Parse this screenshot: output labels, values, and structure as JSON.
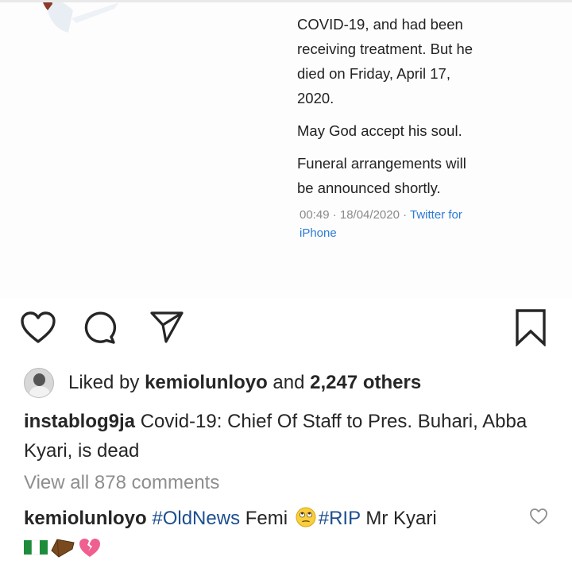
{
  "tweet": {
    "lines_p1": [
      "COVID-19, and had been",
      "receiving treatment. But he",
      "died on Friday, April 17,",
      "2020."
    ],
    "line_p2": "May God accept his soul.",
    "lines_p3": [
      "Funeral arrangements will",
      "be announced shortly."
    ],
    "meta_time": "00:49 · 18/04/2020 · ",
    "meta_source_1": "Twitter for",
    "meta_source_2": "iPhone"
  },
  "actions": {
    "like_icon": "heart-icon",
    "comment_icon": "comment-bubble-icon",
    "share_icon": "paper-plane-icon",
    "save_icon": "bookmark-icon"
  },
  "likes": {
    "prefix": "Liked by ",
    "user": "kemiolunloyo",
    "middle": " and ",
    "count": "2,247 others"
  },
  "caption": {
    "username": "instablog9ja",
    "text": " Covid-19: Chief Of Staff to Pres. Buhari, Abba Kyari, is dead"
  },
  "view_comments": "View all 878 comments",
  "comment": {
    "username": "kemiolunloyo",
    "hashtag1": "#OldNews",
    "text1": " Femi ",
    "emoji_face": "🙄",
    "hashtag2": "#RIP",
    "text2": " Mr Kyari",
    "emoji_row": "🇳🇬⚰️💔"
  },
  "colors": {
    "text": "#262626",
    "muted": "#8e8e8e",
    "hashtag": "#1d4f8f",
    "tweet_link": "#2c7bd6"
  }
}
